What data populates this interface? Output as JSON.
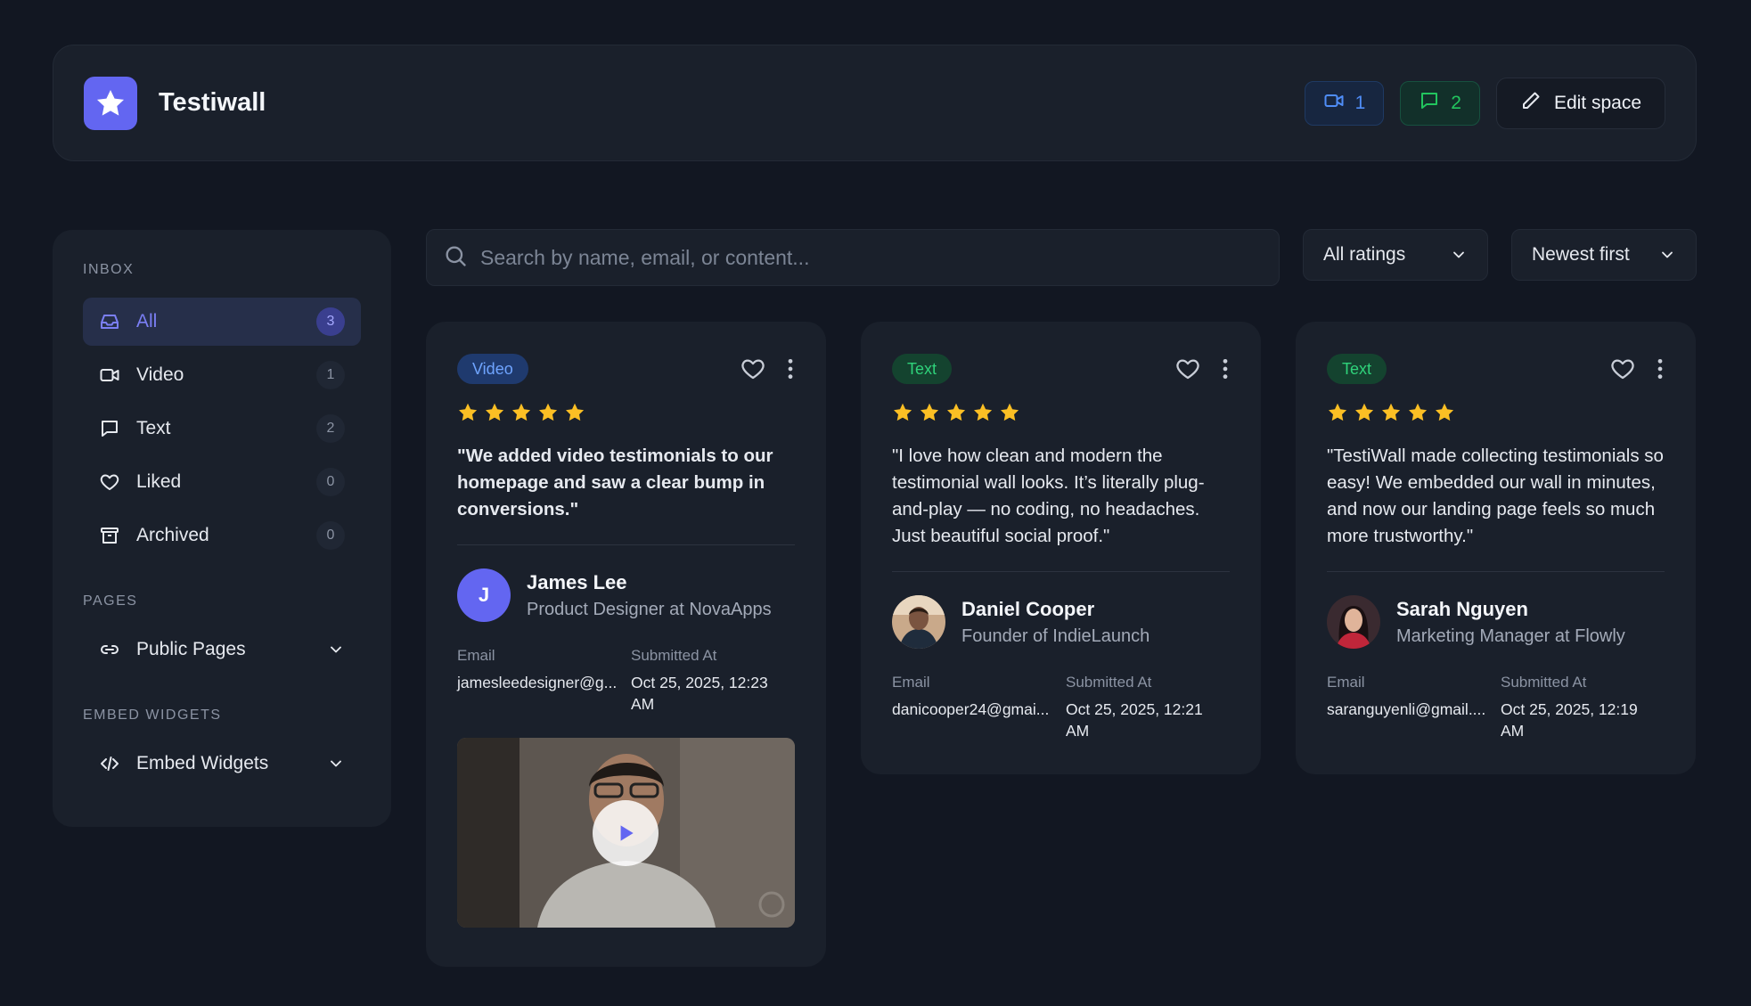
{
  "app": {
    "name": "Testiwall"
  },
  "header": {
    "video_count": "1",
    "text_count": "2",
    "edit_label": "Edit space"
  },
  "sidebar": {
    "inbox_title": "INBOX",
    "items": [
      {
        "label": "All",
        "count": "3",
        "icon": "inbox-icon",
        "active": true
      },
      {
        "label": "Video",
        "count": "1",
        "icon": "video-icon"
      },
      {
        "label": "Text",
        "count": "2",
        "icon": "message-icon"
      },
      {
        "label": "Liked",
        "count": "0",
        "icon": "heart-icon"
      },
      {
        "label": "Archived",
        "count": "0",
        "icon": "archive-icon"
      }
    ],
    "pages_title": "PAGES",
    "public_pages": "Public Pages",
    "embed_title": "EMBED WIDGETS",
    "embed_widgets": "Embed Widgets"
  },
  "search": {
    "placeholder": "Search by name, email, or content..."
  },
  "filters": {
    "rating": "All ratings",
    "sort": "Newest first"
  },
  "labels": {
    "email": "Email",
    "submitted": "Submitted At"
  },
  "cards": [
    {
      "type": "Video",
      "rating": 5,
      "quote": "\"We added video testimonials to our homepage and saw a clear bump in conversions.\"",
      "name": "James Lee",
      "role": "Product Designer at NovaApps",
      "initial": "J",
      "email": "jamesleedesigner@g...",
      "submitted": "Oct 25, 2025, 12:23 AM"
    },
    {
      "type": "Text",
      "rating": 5,
      "quote": "\"I love how clean and modern the testimonial wall looks. It’s literally plug-and-play — no coding, no headaches. Just beautiful social proof.\"",
      "name": "Daniel Cooper",
      "role": "Founder of IndieLaunch",
      "email": "danicooper24@gmai...",
      "submitted": "Oct 25, 2025, 12:21 AM"
    },
    {
      "type": "Text",
      "rating": 5,
      "quote": "\"TestiWall made collecting testimonials so easy! We embedded our wall in minutes, and now our landing page feels so much more trustworthy.\"",
      "name": "Sarah Nguyen",
      "role": "Marketing Manager at Flowly",
      "email": "saranguyenli@gmail....",
      "submitted": "Oct 25, 2025, 12:19 AM"
    }
  ],
  "colors": {
    "accent": "#6366f1",
    "star": "#fbbf24",
    "background": "#121722",
    "panel": "#1a202b"
  }
}
